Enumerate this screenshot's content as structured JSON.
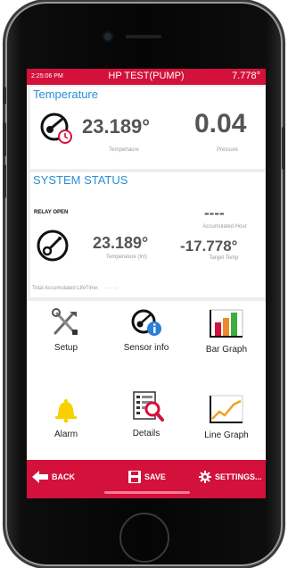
{
  "status": {
    "time": "2:25:06 PM",
    "title": "HP TEST(PUMP)",
    "temp": "7.778°"
  },
  "temperature_panel": {
    "title": "Temperature",
    "value": "23.189°",
    "value_label": "Tempertaure",
    "pressure": "0.04",
    "pressure_label": "Pressure"
  },
  "system_status": {
    "title": "SYSTEM STATUS",
    "relay": "RELAY OPEN",
    "accumulated_hour": "----",
    "accumulated_hour_label": "Accumulated Hour",
    "temp_int": "23.189°",
    "temp_int_label": "Temperature (Int)",
    "target_temp": "-17.778°",
    "target_temp_label": "Target Temp",
    "lifetime_label": "Total Accumulated LifeTime:",
    "lifetime_value": "-- -- --"
  },
  "menu": {
    "setup": "Setup",
    "sensor_info": "Sensor info",
    "bar_graph": "Bar Graph",
    "alarm": "Alarm",
    "details": "Details",
    "line_graph": "Line Graph"
  },
  "toolbar": {
    "back": "BACK",
    "save": "SAVE",
    "settings": "SETTINGS..."
  },
  "colors": {
    "accent": "#d3113b",
    "title_blue": "#2a8fd6"
  }
}
